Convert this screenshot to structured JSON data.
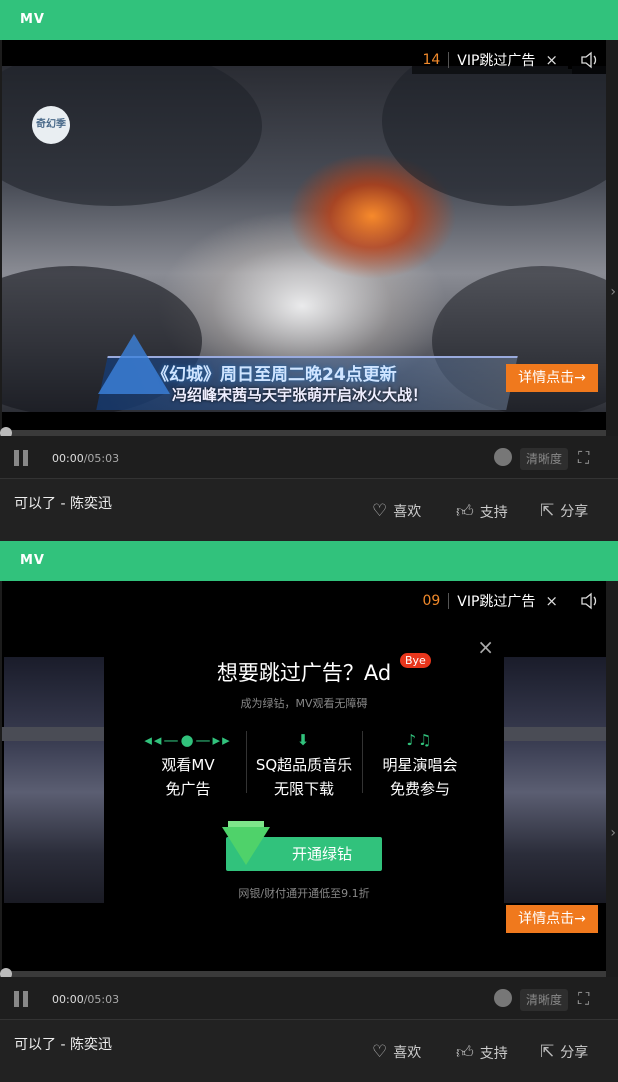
{
  "panels": [
    {
      "header_title": "MV",
      "countdown": {
        "seconds": "14",
        "vip_label": "VIP跳过广告",
        "close": "×"
      },
      "video": {
        "channel_logo": "奇幻季",
        "banner_line1": "《幻城》周日至周二晚24点更新",
        "banner_line2": "冯绍峰宋茜马天宇张萌开启冰火大战！"
      },
      "detail_label": "详情点击",
      "detail_arrow": "→",
      "controls": {
        "current_time": "00:00",
        "total_time": "/05:03",
        "quality": "清晰度"
      },
      "song_title": "可以了 - 陈奕迅",
      "actions": {
        "like": "喜欢",
        "support": "支持",
        "share": "分享"
      }
    },
    {
      "header_title": "MV",
      "countdown": {
        "seconds": "09",
        "vip_label": "VIP跳过广告",
        "close": "×"
      },
      "ad_modal": {
        "title": "想要跳过广告？Ad",
        "badge": "Bye",
        "subtitle": "成为绿钻，MV观看无障碍",
        "features": [
          {
            "line1": "观看MV",
            "line2": "免广告",
            "icon": "fast-forward-icon"
          },
          {
            "line1": "SQ超品质音乐",
            "line2": "无限下载",
            "icon": "download-icon"
          },
          {
            "line1": "明星演唱会",
            "line2": "免费参与",
            "icon": "concert-icon"
          }
        ],
        "button": "开通绿钻",
        "note": "网银/财付通开通低至9.1折",
        "close": "×"
      },
      "detail_label": "详情点击",
      "detail_arrow": "→",
      "controls": {
        "current_time": "00:00",
        "total_time": "/05:03",
        "quality": "清晰度"
      },
      "song_title": "可以了 - 陈奕迅",
      "actions": {
        "like": "喜欢",
        "support": "支持",
        "share": "分享"
      }
    }
  ],
  "colors": {
    "accent": "#31c27c",
    "detail": "#f0791d",
    "countdown": "#f0892b"
  }
}
